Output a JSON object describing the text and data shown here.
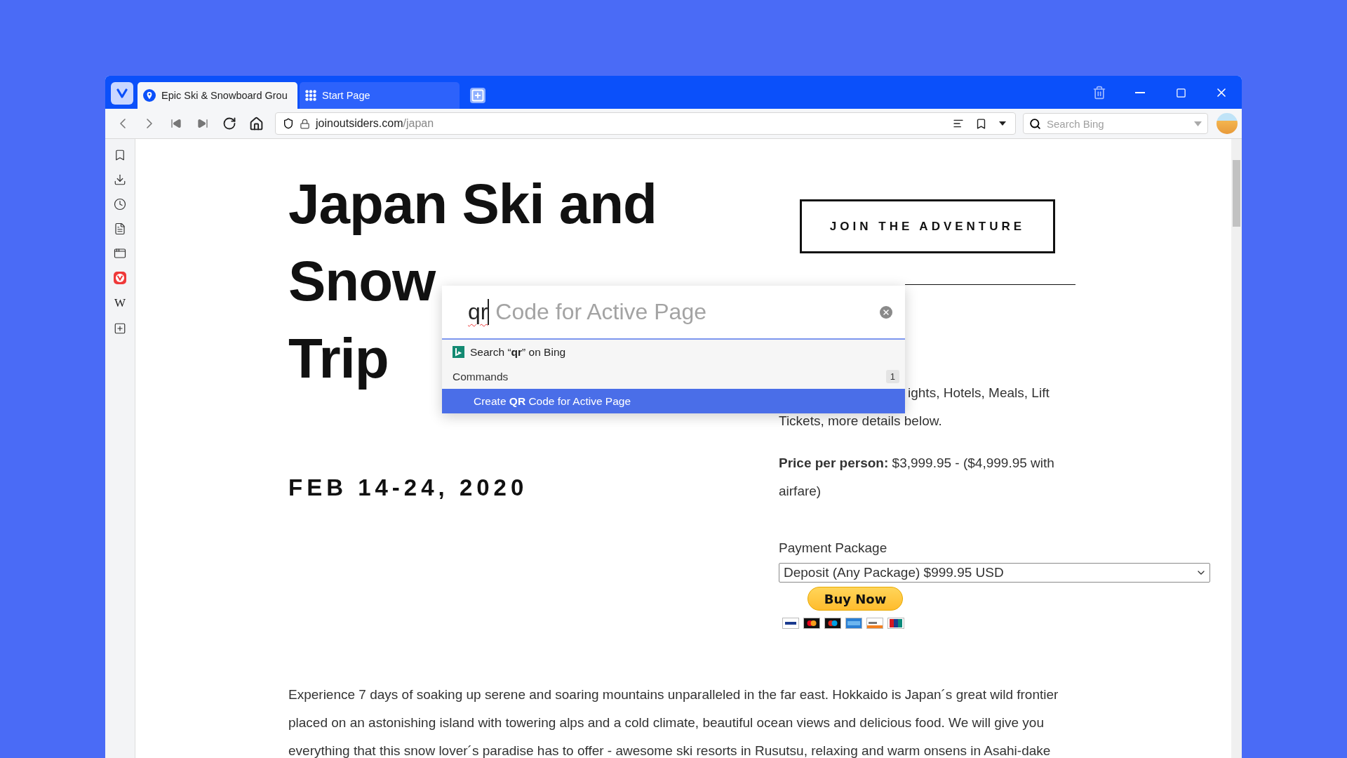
{
  "tabs": [
    {
      "title": "Epic Ski & Snowboard Grou",
      "kind": "site",
      "selected": true
    },
    {
      "title": "Start Page",
      "kind": "speed-dial",
      "selected": false
    }
  ],
  "address_bar": {
    "domain": "joinoutsiders.com",
    "path": "/japan"
  },
  "search": {
    "placeholder": "Search Bing"
  },
  "sidebar": {
    "web_panel_glyph": "W"
  },
  "page": {
    "heading_lines": [
      "Japan Ski and",
      "Snow",
      "Trip"
    ],
    "cta": "JOIN THE ADVENTURE",
    "dates": "FEB 14-24, 2020",
    "includes_lines": [
      "ights, Hotels, Meals, Lift",
      "Tickets, more details below."
    ],
    "price": "**Price per person:** $3,999.95 - ($4,999.95  with airfare)",
    "payment_label": "Payment Package",
    "payment_value": "Deposit (Any Package) $999.95 USD",
    "buy_button": "Buy Now",
    "intro": "Experience 7 days of soaking up serene and soaring mountains unparalleled in the far east. Hokkaido is Japan´s great wild frontier placed on an astonishing island with towering alps and a cold climate, beautiful ocean views and delicious food. We will give you everything that this snow lover´s paradise has to offer - awesome ski resorts in Rusutsu, relaxing and warm onsens in Asahi-dake"
  },
  "quick_commands": {
    "typed": "qr",
    "completion": " Code for Active Page",
    "results": [
      {
        "kind": "search",
        "text": "Search “**qr**” on Bing",
        "selected": false
      },
      {
        "kind": "header",
        "text": "Commands",
        "count": "1"
      },
      {
        "kind": "command",
        "text": "Create **QR** Code for Active Page",
        "selected": true
      }
    ]
  }
}
